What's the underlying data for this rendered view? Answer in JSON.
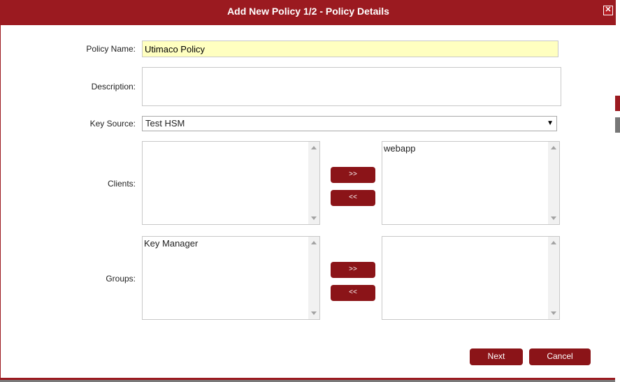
{
  "dialog": {
    "title": "Add New Policy 1/2 - Policy Details",
    "close_glyph": "✕"
  },
  "form": {
    "policy_name_label": "Policy Name:",
    "policy_name_value": "Utimaco Policy",
    "description_label": "Description:",
    "description_value": "",
    "key_source_label": "Key Source:",
    "key_source_value": "Test HSM",
    "clients_label": "Clients:",
    "clients_available": [],
    "clients_selected": [
      "webapp"
    ],
    "groups_label": "Groups:",
    "groups_available": [
      "Key Manager"
    ],
    "groups_selected": []
  },
  "buttons": {
    "add": ">>",
    "remove": "<<",
    "next": "Next",
    "cancel": "Cancel"
  },
  "icons": {
    "select_arrow": "▼"
  },
  "colors": {
    "brand": "#9b1a20",
    "button": "#8b1418",
    "name_highlight": "#ffffc0"
  }
}
